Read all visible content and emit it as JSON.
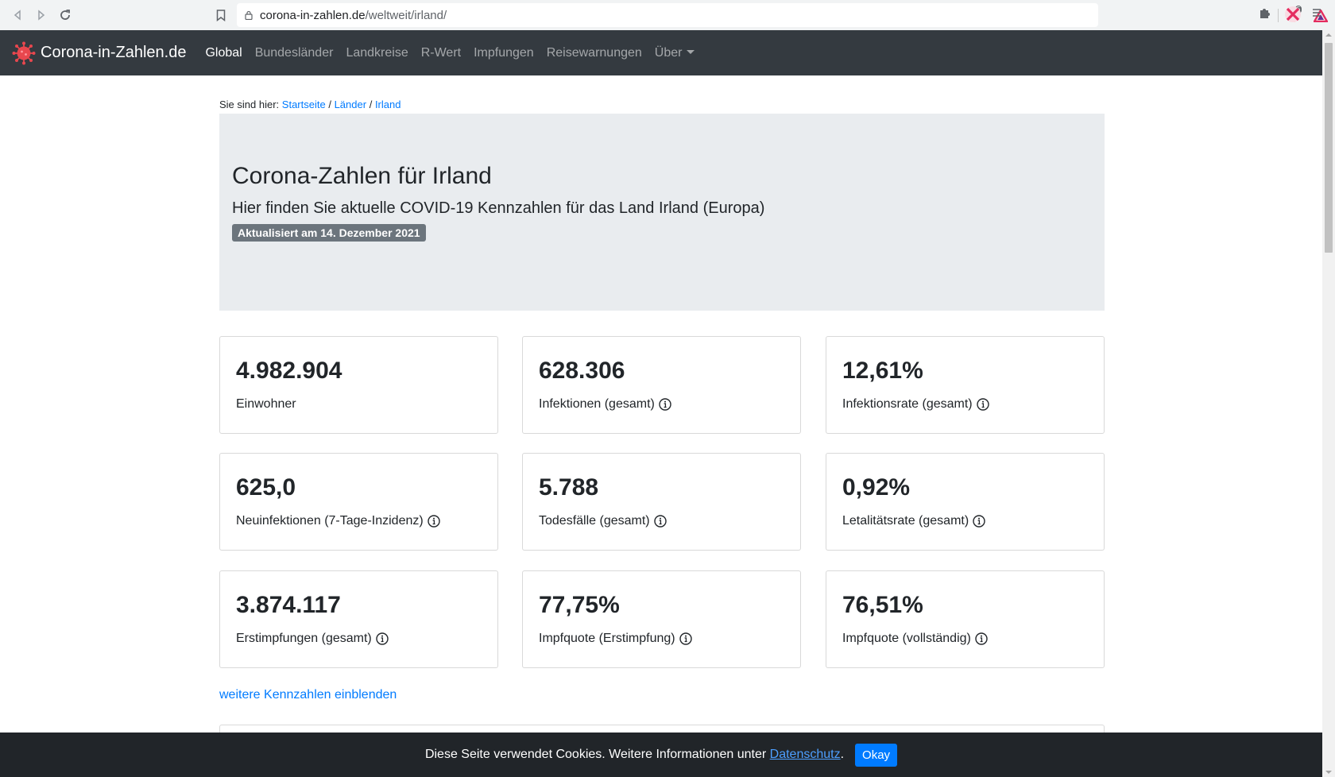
{
  "browser": {
    "url_host": "corona-in-zahlen.de",
    "url_path": "/weltweit/irland/",
    "brave_badge_count": "5"
  },
  "navbar": {
    "brand": "Corona-in-Zahlen.de",
    "items": [
      {
        "label": "Global",
        "active": true
      },
      {
        "label": "Bundesländer"
      },
      {
        "label": "Landkreise"
      },
      {
        "label": "R-Wert"
      },
      {
        "label": "Impfungen"
      },
      {
        "label": "Reisewarnungen"
      },
      {
        "label": "Über"
      }
    ]
  },
  "breadcrumb": {
    "prefix": "Sie sind hier:",
    "items": [
      "Startseite",
      "Länder",
      "Irland"
    ],
    "separator": "/"
  },
  "hero": {
    "title": "Corona-Zahlen für Irland",
    "subtitle": "Hier finden Sie aktuelle COVID-19 Kennzahlen für das Land Irland (Europa)",
    "badge": "Aktualisiert am 14. Dezember 2021"
  },
  "stats": [
    {
      "value": "4.982.904",
      "label": "Einwohner"
    },
    {
      "value": "628.306",
      "label": "Infektionen (gesamt)"
    },
    {
      "value": "12,61%",
      "label": "Infektionsrate (gesamt)"
    },
    {
      "value": "625,0",
      "label": "Neuinfektionen (7-Tage-Inzidenz)"
    },
    {
      "value": "5.788",
      "label": "Todesfälle (gesamt)"
    },
    {
      "value": "0,92%",
      "label": "Letalitätsrate (gesamt)"
    },
    {
      "value": "3.874.117",
      "label": "Erstimpfungen (gesamt)"
    },
    {
      "value": "77,75%",
      "label": "Impfquote (Erstimpfung)"
    },
    {
      "value": "76,51%",
      "label": "Impfquote (vollständig)"
    }
  ],
  "more_link": "weitere Kennzahlen einblenden",
  "cookie": {
    "text": "Diese Seite verwendet Cookies. Weitere Informationen unter",
    "link": "Datenschutz",
    "end": ".",
    "button": "Okay"
  },
  "colors": {
    "navbar_bg": "#343a40",
    "link": "#007bff",
    "jumbotron_bg": "#e9ecef",
    "badge_bg": "#6c757d",
    "cookie_bg": "#212529",
    "brand_icon": "#e8474e"
  }
}
